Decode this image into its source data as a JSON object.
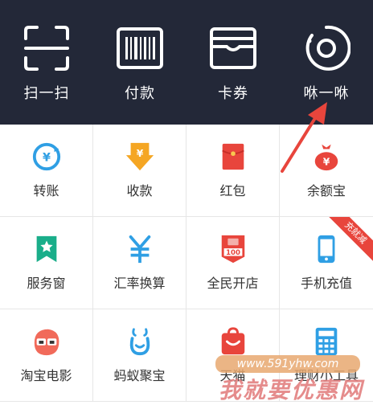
{
  "top": {
    "items": [
      {
        "label": "扫一扫",
        "icon": "scan-icon"
      },
      {
        "label": "付款",
        "icon": "barcode-icon"
      },
      {
        "label": "卡券",
        "icon": "wallet-icon"
      },
      {
        "label": "咻一咻",
        "icon": "radar-icon"
      }
    ],
    "background": "#232838"
  },
  "grid": {
    "cells": [
      {
        "label": "转账",
        "icon": "transfer-icon"
      },
      {
        "label": "收款",
        "icon": "receive-money-icon"
      },
      {
        "label": "红包",
        "icon": "red-envelope-icon"
      },
      {
        "label": "余额宝",
        "icon": "money-bag-icon"
      },
      {
        "label": "服务窗",
        "icon": "bookmark-star-icon"
      },
      {
        "label": "汇率换算",
        "icon": "yuan-exchange-icon"
      },
      {
        "label": "全民开店",
        "icon": "store-100-icon"
      },
      {
        "label": "手机充值",
        "icon": "phone-icon"
      },
      {
        "label": "淘宝电影",
        "icon": "movie-mascot-icon"
      },
      {
        "label": "蚂蚁聚宝",
        "icon": "ant-fortune-icon"
      },
      {
        "label": "天猫",
        "icon": "tmall-bag-icon"
      },
      {
        "label": "理财小工具",
        "icon": "calculator-icon"
      }
    ],
    "badge": "充就减"
  },
  "watermark": {
    "url": "www.591yhw.com",
    "slogan": "我就要优惠网"
  },
  "colors": {
    "blue": "#2f9fe4",
    "orange": "#f5a623",
    "red": "#e8453c",
    "green": "#1aae8a"
  }
}
